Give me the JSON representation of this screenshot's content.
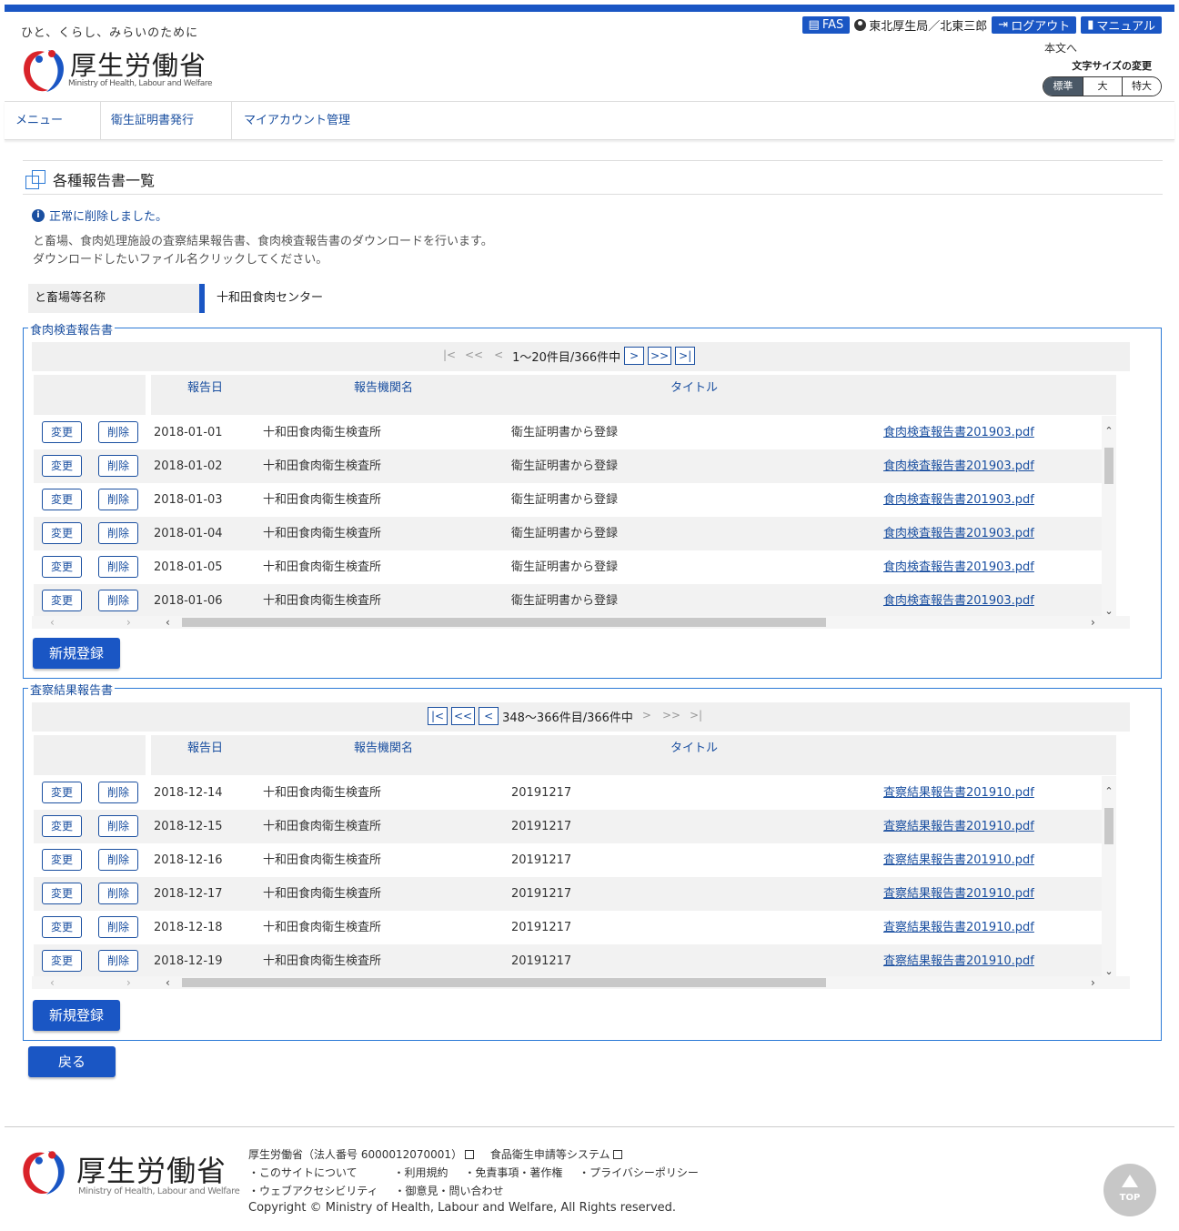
{
  "header": {
    "tagline": "ひと、くらし、みらいのために",
    "logo_name": "厚生労働省",
    "logo_sub": "Ministry of Health, Labour and Welfare",
    "fas_label": "FAS",
    "user_label": "東北厚生局／北東三郎",
    "logout_label": "ログアウト",
    "manual_label": "マニュアル",
    "skip_link": "本文へ",
    "font_size_label": "文字サイズの変更",
    "font_sizes": [
      "標準",
      "大",
      "特大"
    ]
  },
  "nav": {
    "items": [
      "メニュー",
      "衛生証明書発行",
      "マイアカウント管理"
    ]
  },
  "page": {
    "title": "各種報告書一覧",
    "message": "正常に削除しました。",
    "desc_line1": "と畜場、食肉処理施設の査察結果報告書、食肉検査報告書のダウンロードを行います。",
    "desc_line2": "ダウンロードしたいファイル名クリックしてください。",
    "facility_label": "と畜場等名称",
    "facility_value": "十和田食肉センター",
    "back_label": "戻る"
  },
  "columns": {
    "date": "報告日",
    "org": "報告機関名",
    "title": "タイトル"
  },
  "buttons": {
    "edit": "変更",
    "delete": "削除",
    "new": "新規登録"
  },
  "inspection": {
    "legend": "食肉検査報告書",
    "pager": {
      "first": "|<",
      "prev2": "<<",
      "prev": "<",
      "range": "1～20件目/366件中",
      "next": ">",
      "next2": ">>",
      "last": ">|"
    },
    "rows": [
      {
        "date": "2018-01-01",
        "org": "十和田食肉衛生検査所",
        "title": "衛生証明書から登録",
        "file": "食肉検査報告書201903.pdf"
      },
      {
        "date": "2018-01-02",
        "org": "十和田食肉衛生検査所",
        "title": "衛生証明書から登録",
        "file": "食肉検査報告書201903.pdf"
      },
      {
        "date": "2018-01-03",
        "org": "十和田食肉衛生検査所",
        "title": "衛生証明書から登録",
        "file": "食肉検査報告書201903.pdf"
      },
      {
        "date": "2018-01-04",
        "org": "十和田食肉衛生検査所",
        "title": "衛生証明書から登録",
        "file": "食肉検査報告書201903.pdf"
      },
      {
        "date": "2018-01-05",
        "org": "十和田食肉衛生検査所",
        "title": "衛生証明書から登録",
        "file": "食肉検査報告書201903.pdf"
      },
      {
        "date": "2018-01-06",
        "org": "十和田食肉衛生検査所",
        "title": "衛生証明書から登録",
        "file": "食肉検査報告書201903.pdf"
      }
    ]
  },
  "audit": {
    "legend": "査察結果報告書",
    "pager": {
      "first": "|<",
      "prev2": "<<",
      "prev": "<",
      "range": "348～366件目/366件中",
      "next": ">",
      "next2": ">>",
      "last": ">|"
    },
    "rows": [
      {
        "date": "2018-12-14",
        "org": "十和田食肉衛生検査所",
        "title": "20191217",
        "file": "査察結果報告書201910.pdf"
      },
      {
        "date": "2018-12-15",
        "org": "十和田食肉衛生検査所",
        "title": "20191217",
        "file": "査察結果報告書201910.pdf"
      },
      {
        "date": "2018-12-16",
        "org": "十和田食肉衛生検査所",
        "title": "20191217",
        "file": "査察結果報告書201910.pdf"
      },
      {
        "date": "2018-12-17",
        "org": "十和田食肉衛生検査所",
        "title": "20191217",
        "file": "査察結果報告書201910.pdf"
      },
      {
        "date": "2018-12-18",
        "org": "十和田食肉衛生検査所",
        "title": "20191217",
        "file": "査察結果報告書201910.pdf"
      },
      {
        "date": "2018-12-19",
        "org": "十和田食肉衛生検査所",
        "title": "20191217",
        "file": "査察結果報告書201910.pdf"
      }
    ]
  },
  "footer": {
    "logo_name": "厚生労働省",
    "logo_sub": "Ministry of Health, Labour and Welfare",
    "org_line": "厚生労働省（法人番号 6000012070001）",
    "system_link": "食品衛生申請等システム",
    "links1": [
      "・このサイトについて",
      "・利用規約",
      "・免責事項・著作権",
      "・プライバシーポリシー"
    ],
    "links2": [
      "・ウェブアクセシビリティ",
      "・御意見・問い合わせ"
    ],
    "copyright": "Copyright © Ministry of Health, Labour and Welfare, All Rights reserved.",
    "top_label": "TOP"
  },
  "colors": {
    "brand_blue": "#1a56c4",
    "link_blue": "#1a4fa0",
    "border_blue": "#2c7ad6"
  }
}
